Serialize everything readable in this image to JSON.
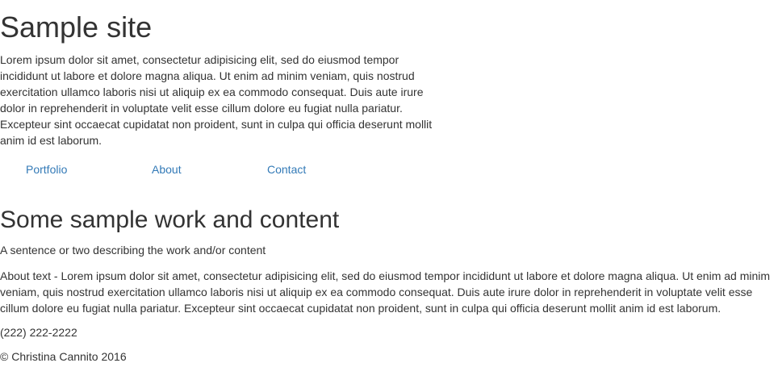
{
  "header": {
    "title": "Sample site",
    "intro": "Lorem ipsum dolor sit amet, consectetur adipisicing elit, sed do eiusmod tempor incididunt ut labore et dolore magna aliqua. Ut enim ad minim veniam, quis nostrud exercitation ullamco laboris nisi ut aliquip ex ea commodo consequat. Duis aute irure dolor in reprehenderit in voluptate velit esse cillum dolore eu fugiat nulla pariatur. Excepteur sint occaecat cupidatat non proident, sunt in culpa qui officia deserunt mollit anim id est laborum."
  },
  "nav": {
    "items": [
      {
        "label": "Portfolio"
      },
      {
        "label": "About"
      },
      {
        "label": "Contact"
      }
    ],
    "link_color": "#337ab7"
  },
  "section": {
    "title": "Some sample work and content",
    "tagline": "A sentence or two describing the work and/or content",
    "about": "About text - Lorem ipsum dolor sit amet, consectetur adipisicing elit, sed do eiusmod tempor incididunt ut labore et dolore magna aliqua. Ut enim ad minim veniam, quis nostrud exercitation ullamco laboris nisi ut aliquip ex ea commodo consequat. Duis aute irure dolor in reprehenderit in voluptate velit esse cillum dolore eu fugiat nulla pariatur. Excepteur sint occaecat cupidatat non proident, sunt in culpa qui officia deserunt mollit anim id est laborum."
  },
  "footer": {
    "phone": "(222) 222-2222",
    "copyright": "© Christina Cannito 2016"
  },
  "colors": {
    "text": "#333333",
    "background": "#ffffff"
  }
}
